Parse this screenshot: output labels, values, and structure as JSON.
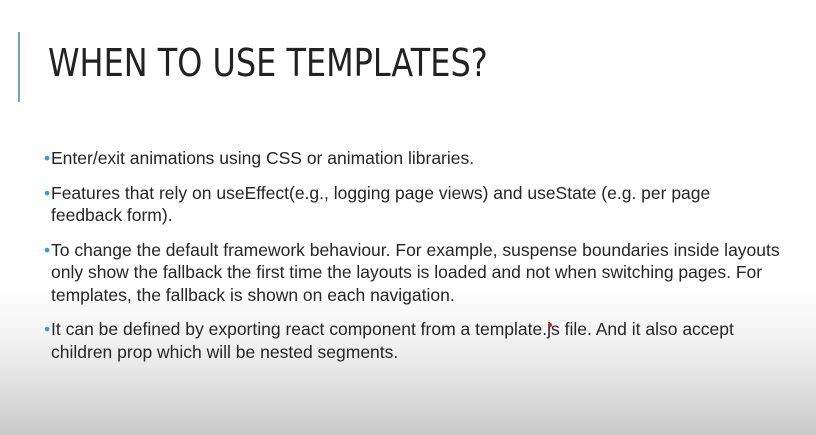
{
  "slide": {
    "title": "WHEN TO USE TEMPLATES?",
    "bullet_glyph": "•",
    "bullets": [
      {
        "text": "Enter/exit animations using CSS or animation libraries."
      },
      {
        "text": "Features that rely on useEffect(e.g., logging page views) and useState (e.g. per page feedback form)."
      },
      {
        "text": "To change the default framework behaviour. For example, suspense boundaries inside layouts only show the fallback the first time the layouts is loaded and not when switching pages. For templates, the fallback is shown on each navigation."
      },
      {
        "text": "It can be defined by exporting react component from a template.js file. And it also accept children prop which will be nested segments."
      }
    ],
    "colors": {
      "accent_bar": "#6fa8b4",
      "bullet": "#3b9bd6",
      "text": "#262626",
      "pointer": "#e01b1b"
    }
  }
}
